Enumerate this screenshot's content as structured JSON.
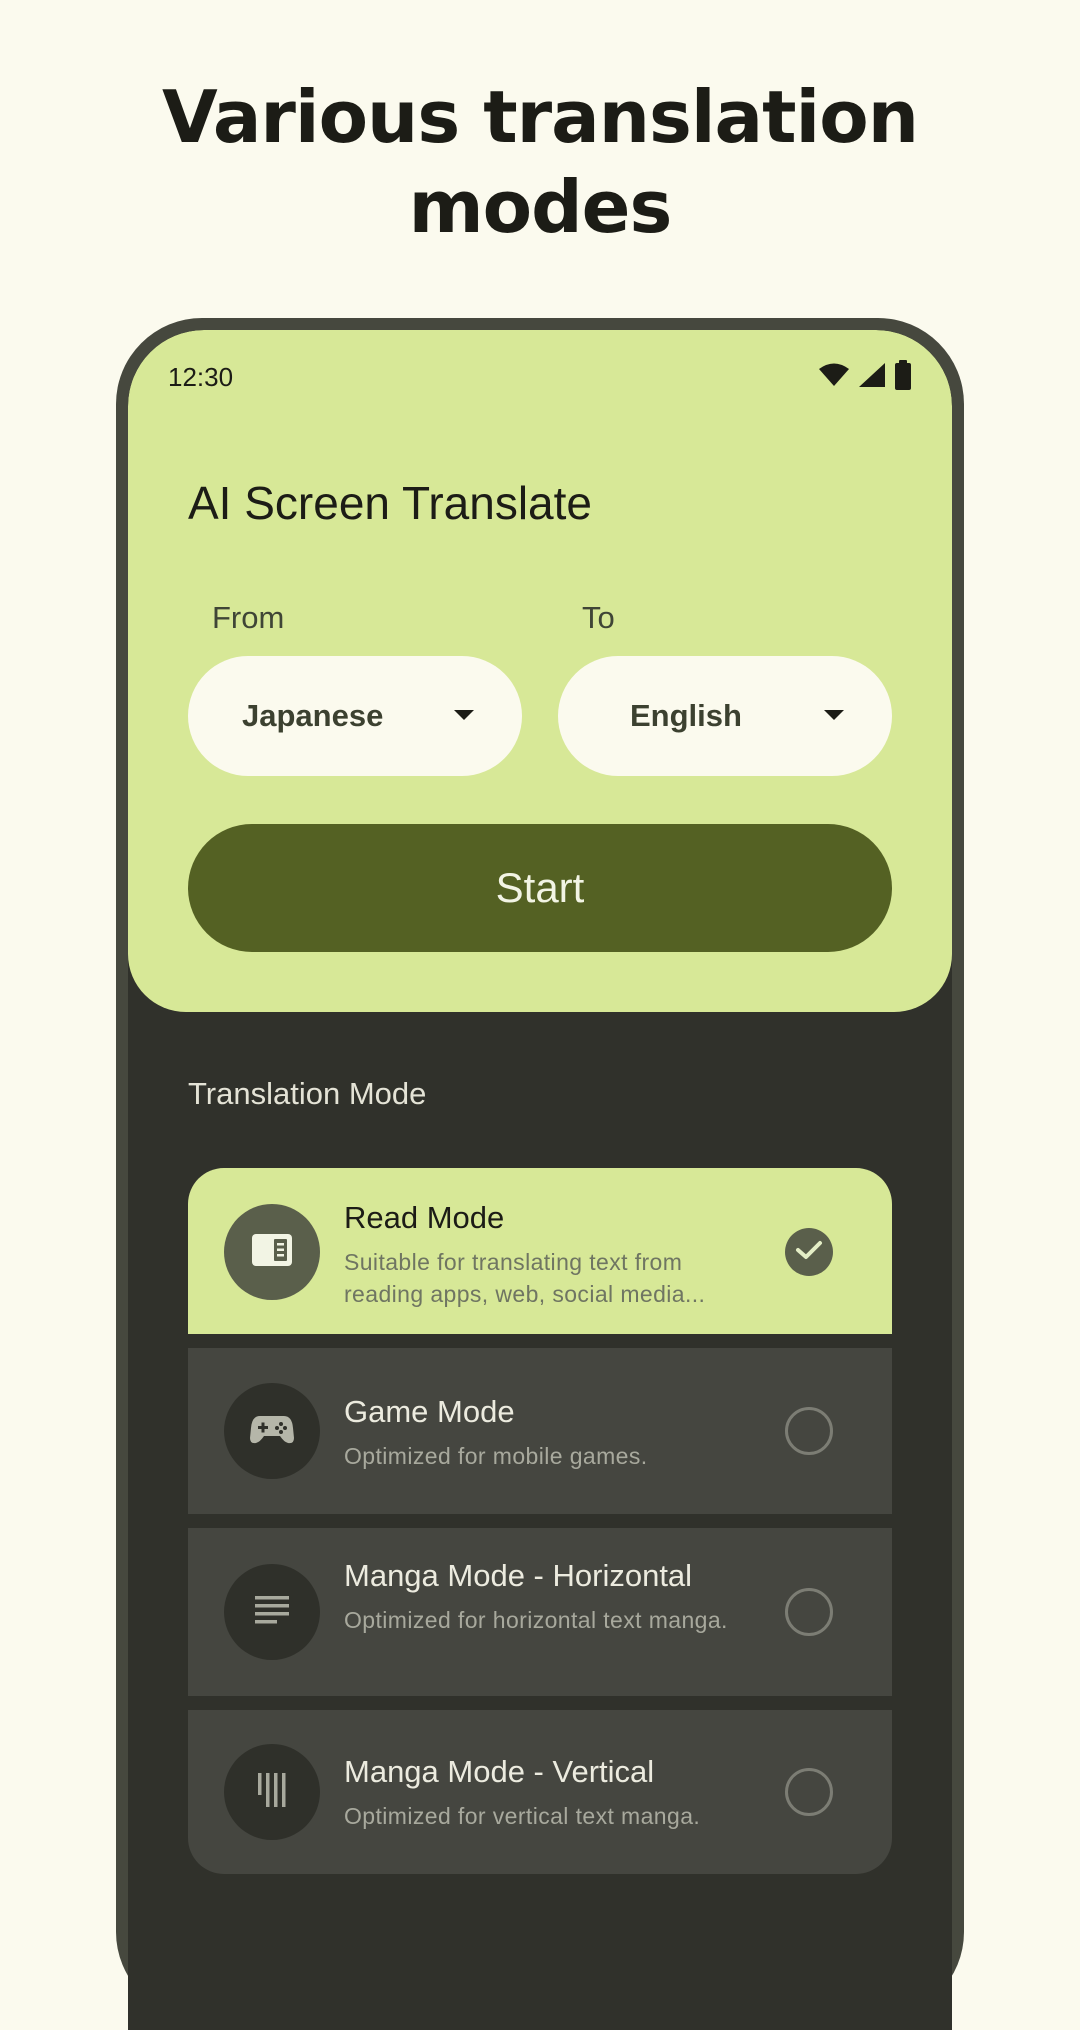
{
  "promo": {
    "title_line1": "Various translation",
    "title_line2": "modes"
  },
  "status_bar": {
    "time": "12:30",
    "icons": [
      "wifi-icon",
      "signal-icon",
      "battery-icon"
    ]
  },
  "app": {
    "title": "AI Screen Translate"
  },
  "languages": {
    "from_label": "From",
    "from_value": "Japanese",
    "to_label": "To",
    "to_value": "English"
  },
  "start_button": {
    "label": "Start"
  },
  "translation_mode": {
    "section_title": "Translation Mode",
    "modes": [
      {
        "name": "Read Mode",
        "description": "Suitable for translating text from reading apps, web, social media...",
        "icon": "reader-icon",
        "selected": true
      },
      {
        "name": "Game Mode",
        "description": "Optimized for mobile games.",
        "icon": "gamepad-icon",
        "selected": false
      },
      {
        "name": "Manga Mode - Horizontal",
        "description": "Optimized for horizontal text manga.",
        "icon": "horizontal-lines-icon",
        "selected": false
      },
      {
        "name": "Manga Mode - Vertical",
        "description": "Optimized for vertical text manga.",
        "icon": "vertical-lines-icon",
        "selected": false
      }
    ]
  },
  "colors": {
    "page_background": "#fbfaee",
    "panel_green": "#d7e897",
    "button_olive": "#546123",
    "screen_dark": "#30312b",
    "card_dark": "#454640"
  }
}
